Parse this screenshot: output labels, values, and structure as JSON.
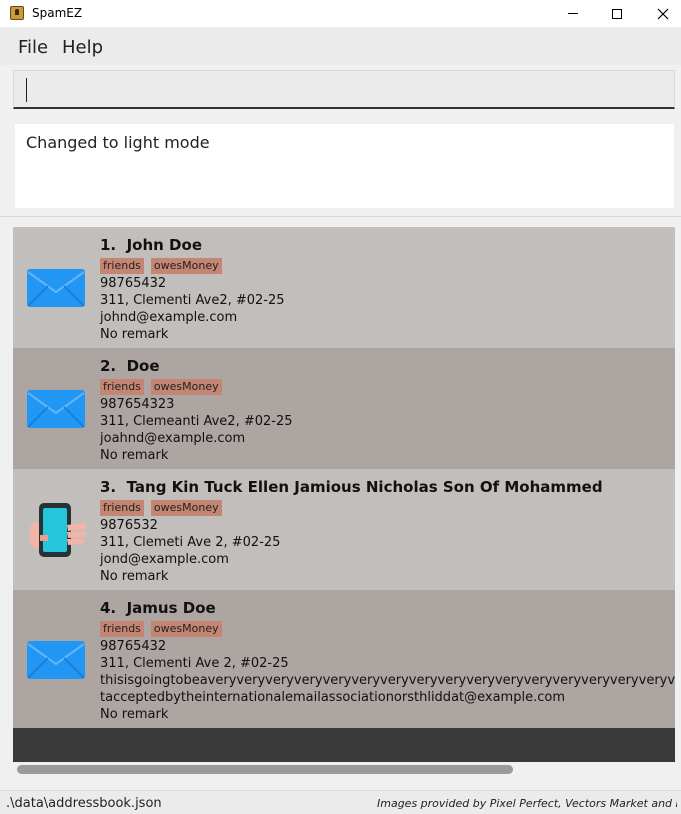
{
  "window": {
    "title": "SpamEZ",
    "icon": "app-book-icon",
    "controls": [
      "minimize-icon",
      "maximize-icon",
      "close-icon"
    ]
  },
  "menu": {
    "file_label": "File",
    "help_label": "Help"
  },
  "command": {
    "value": "",
    "placeholder": ""
  },
  "result": {
    "message": "Changed to light mode"
  },
  "persons": [
    {
      "index": "1.",
      "name": "John Doe",
      "tags": [
        "friends",
        "owesMoney"
      ],
      "phone": "98765432",
      "address": "311, Clementi Ave2, #02-25",
      "email": "johnd@example.com",
      "remark": "No remark",
      "icon": "envelope-icon"
    },
    {
      "index": "2.",
      "name": "Doe",
      "tags": [
        "friends",
        "owesMoney"
      ],
      "phone": "987654323",
      "address": "311, Clemeanti Ave2, #02-25",
      "email": "joahnd@example.com",
      "remark": "No remark",
      "icon": "envelope-icon"
    },
    {
      "index": "3.",
      "name": "Tang Kin Tuck Ellen Jamious Nicholas Son Of Mohammed",
      "tags": [
        "friends",
        "owesMoney"
      ],
      "phone": "9876532",
      "address": "311, Clemeti Ave 2, #02-25",
      "email": "jond@example.com",
      "remark": "No remark",
      "icon": "phone-in-hand-icon"
    },
    {
      "index": "4.",
      "name": "Jamus Doe",
      "tags": [
        "friends",
        "owesMoney"
      ],
      "phone": "98765432",
      "address": "311, Clementi Ave 2, #02-25",
      "email_line1": "thisisgoingtobeaveryveryveryveryveryveryveryveryveryveryveryveryveryveryveryveryveryveryveryveryveryveryveryveryveryveryveryveryvery",
      "email_line2": "tacceptedbytheinternationalemailassociationorsthliddat@example.com",
      "remark": "No remark",
      "icon": "envelope-icon"
    }
  ],
  "status": {
    "file_path": ".\\data\\addressbook.json",
    "credits": "Images provided by Pixel Perfect, Vectors Market and Fre..."
  },
  "colors": {
    "card_odd": "#c1bebb",
    "card_even": "#aca5a1",
    "tag": "#c48672",
    "envelope": "#2196f3"
  }
}
